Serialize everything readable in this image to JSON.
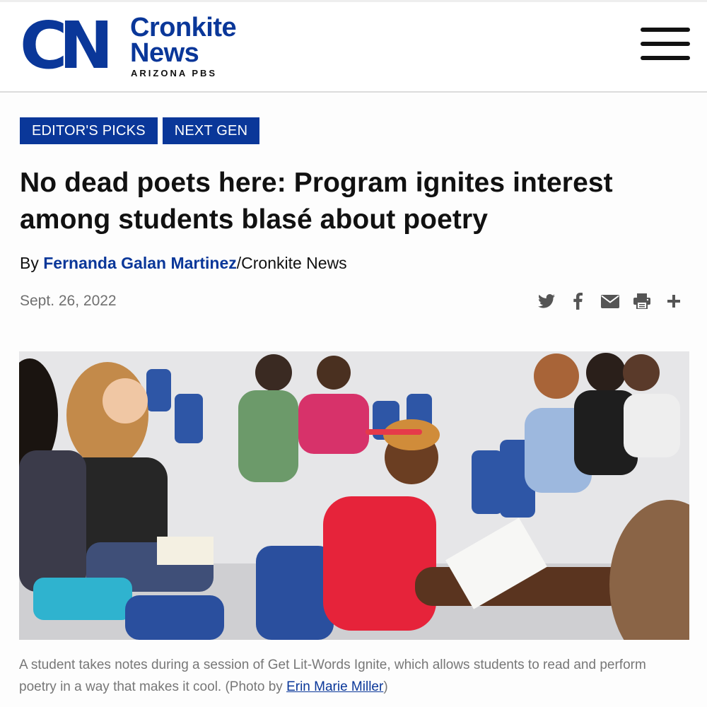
{
  "header": {
    "logo_mark": "CN",
    "logo_word_1": "Cronkite",
    "logo_word_2": "News",
    "logo_sub": "ARIZONA PBS",
    "brand_color": "#0a3799"
  },
  "tags": [
    "EDITOR'S PICKS",
    "NEXT GEN"
  ],
  "article": {
    "title": "No dead poets here: Program ignites interest among students blasé about poetry",
    "byline_prefix": "By ",
    "author": "Fernanda Galan Martinez",
    "byline_suffix": "/Cronkite News",
    "date": "Sept. 26, 2022"
  },
  "share": {
    "icons": [
      "twitter-icon",
      "facebook-icon",
      "email-icon",
      "print-icon",
      "plus-icon"
    ],
    "icon_color": "#555555"
  },
  "photo": {
    "subject": "Students seated in blue chairs taking notes during a poetry session"
  },
  "caption": {
    "text": "A student takes notes during a session of Get Lit-Words Ignite, which allows students to read and perform poetry in a way that makes it cool. (Photo by ",
    "credit": "Erin Marie Miller",
    "end": ")"
  }
}
